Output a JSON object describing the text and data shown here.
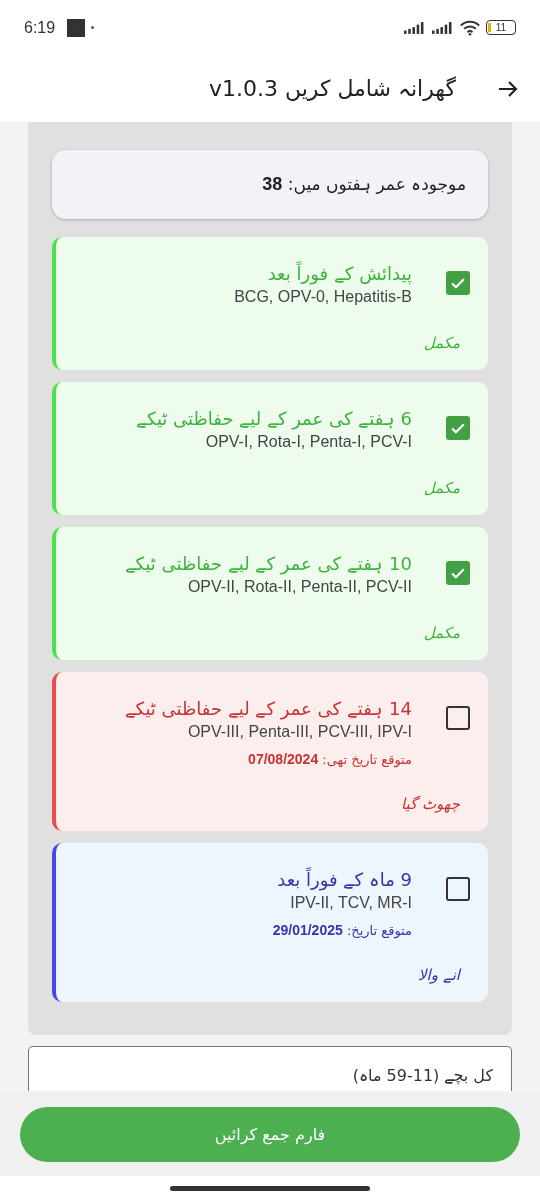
{
  "status_bar": {
    "time": "6:19",
    "battery": "11"
  },
  "app_bar": {
    "title": "گھرانہ شامل کریں v1.0.3"
  },
  "current_age": "موجودہ عمر ہفتوں میں: **38**",
  "vaccines": [
    {
      "title": "پیدائش کے فوراً بعد",
      "doses": "BCG, OPV-0, Hepatitis-B",
      "kind": "completed",
      "status_label": "مکمل",
      "checked": true
    },
    {
      "title": "6 ہفتے کی عمر کے لیے حفاظتی ٹیکے",
      "doses": "OPV-I, Rota-I, Penta-I, PCV-I",
      "kind": "completed",
      "status_label": "مکمل",
      "checked": true
    },
    {
      "title": "10 ہفتے کی عمر کے لیے حفاظتی ٹیکے",
      "doses": "OPV-II, Rota-II, Penta-II, PCV-II",
      "kind": "completed",
      "status_label": "مکمل",
      "checked": true
    },
    {
      "title": "14 ہفتے کی عمر کے لیے حفاظتی ٹیکے",
      "doses": "OPV-III, Penta-III, PCV-III, IPV-I",
      "due": "متوقع تاریخ تھی: **07/08/2024**",
      "kind": "missed",
      "status_label": "چھوٹ گیا",
      "checked": false
    },
    {
      "title": "9 ماہ کے فوراً بعد",
      "doses": "IPV-II, TCV, MR-I",
      "due": "متوقع تاریخ: **29/01/2025**",
      "kind": "upcoming",
      "status_label": "انے والا",
      "checked": false
    }
  ],
  "children_field": {
    "placeholder": "کل بچے (11-59 ماہ)"
  },
  "submit_button": "فارم جمع کرائیں"
}
